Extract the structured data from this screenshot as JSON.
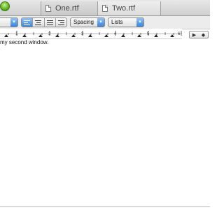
{
  "tabs": [
    {
      "label": "One.rtf"
    },
    {
      "label": "Two.rtf"
    }
  ],
  "toolbar": {
    "spacing_label": "Spacing",
    "lists_label": "Lists"
  },
  "ruler": {
    "numbers": [
      "1",
      "2",
      "3",
      "4",
      "5",
      "6"
    ]
  },
  "document": {
    "text": "my second window."
  }
}
